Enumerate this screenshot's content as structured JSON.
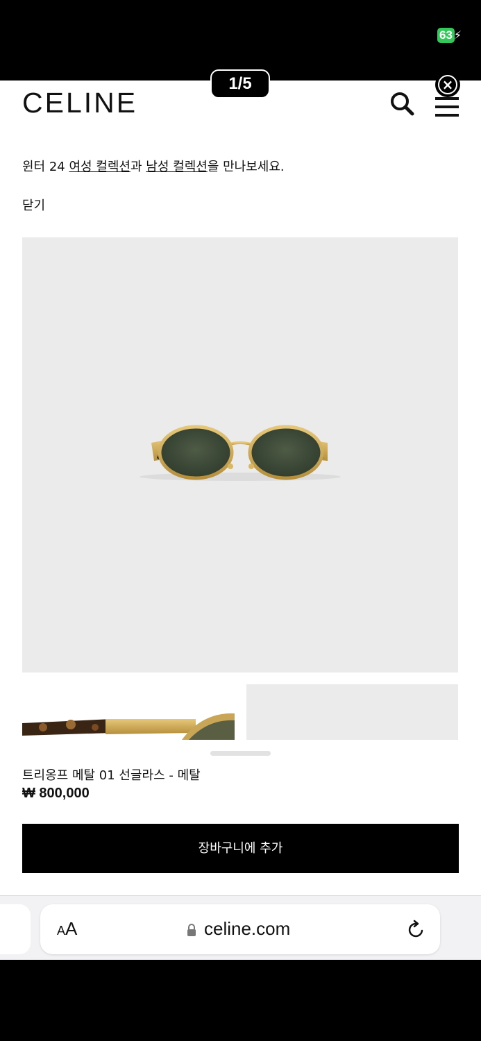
{
  "status": {
    "battery": "63"
  },
  "header": {
    "logo": "CELINE"
  },
  "gallery": {
    "counter": "1/5"
  },
  "promo": {
    "prefix": "윈터 24 ",
    "link1": "여성 컬렉션",
    "mid": "과 ",
    "link2": "남성 컬렉션",
    "suffix": "을 만나보세요."
  },
  "close_text": "닫기",
  "product": {
    "name": "트리옹프 메탈 01 선글라스 - 메탈",
    "price": "₩ 800,000"
  },
  "cart_button": "장바구니에 추가",
  "browser": {
    "aa_small": "A",
    "aa_large": "A",
    "domain": "celine.com"
  },
  "icons": [
    "battery-icon",
    "bolt-icon",
    "search-icon",
    "menu-icon",
    "close-icon",
    "lock-icon",
    "reload-icon"
  ]
}
